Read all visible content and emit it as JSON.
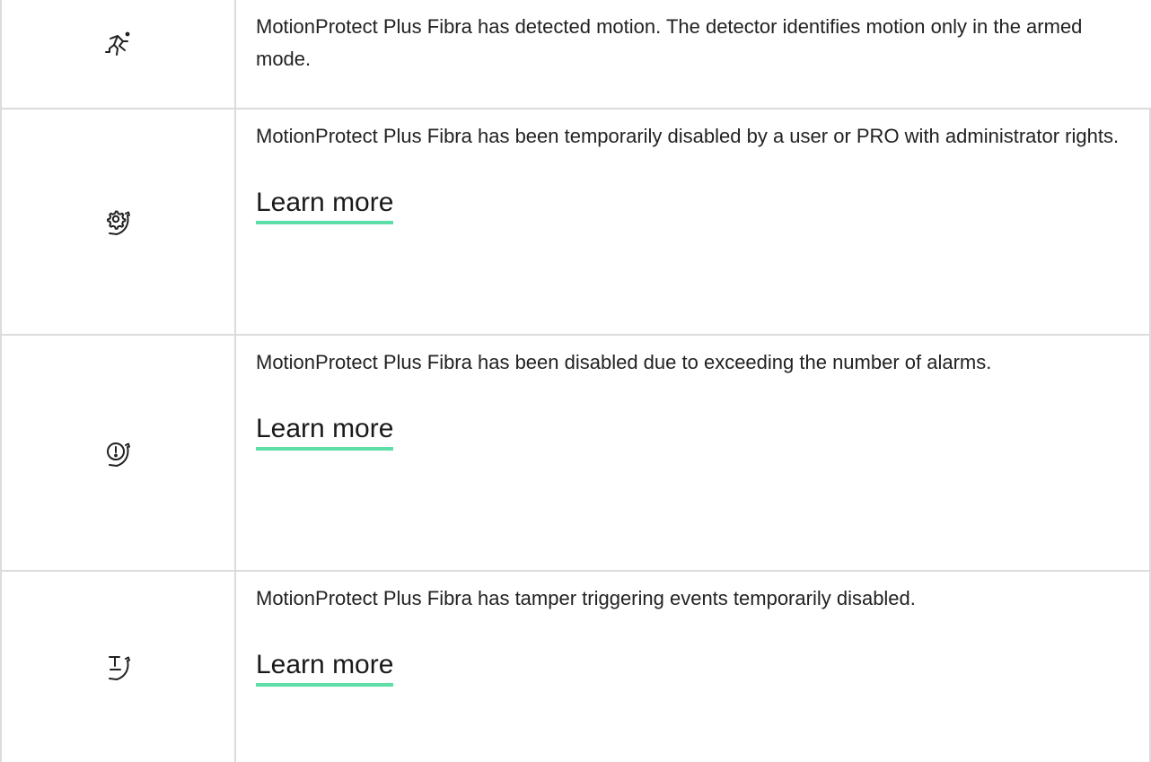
{
  "rows": [
    {
      "icon": "motion-detected-icon",
      "text": "MotionProtect Plus Fibra has detected motion. The detector identifies motion only in the armed mode."
    },
    {
      "icon": "temporarily-disabled-icon",
      "text": "MotionProtect Plus Fibra has been temporarily disabled by a user or PRO with administrator rights.",
      "link": "Learn more"
    },
    {
      "icon": "alarm-limit-disabled-icon",
      "text": "MotionProtect Plus Fibra has been disabled due to exceeding the number of alarms.",
      "link": "Learn more"
    },
    {
      "icon": "tamper-disabled-icon",
      "text": "MotionProtect Plus Fibra has tamper triggering events temporarily disabled.",
      "link": "Learn more"
    }
  ],
  "colors": {
    "link_underline": "#5ddfa7",
    "border": "#dcdcdc",
    "text": "#222222"
  }
}
